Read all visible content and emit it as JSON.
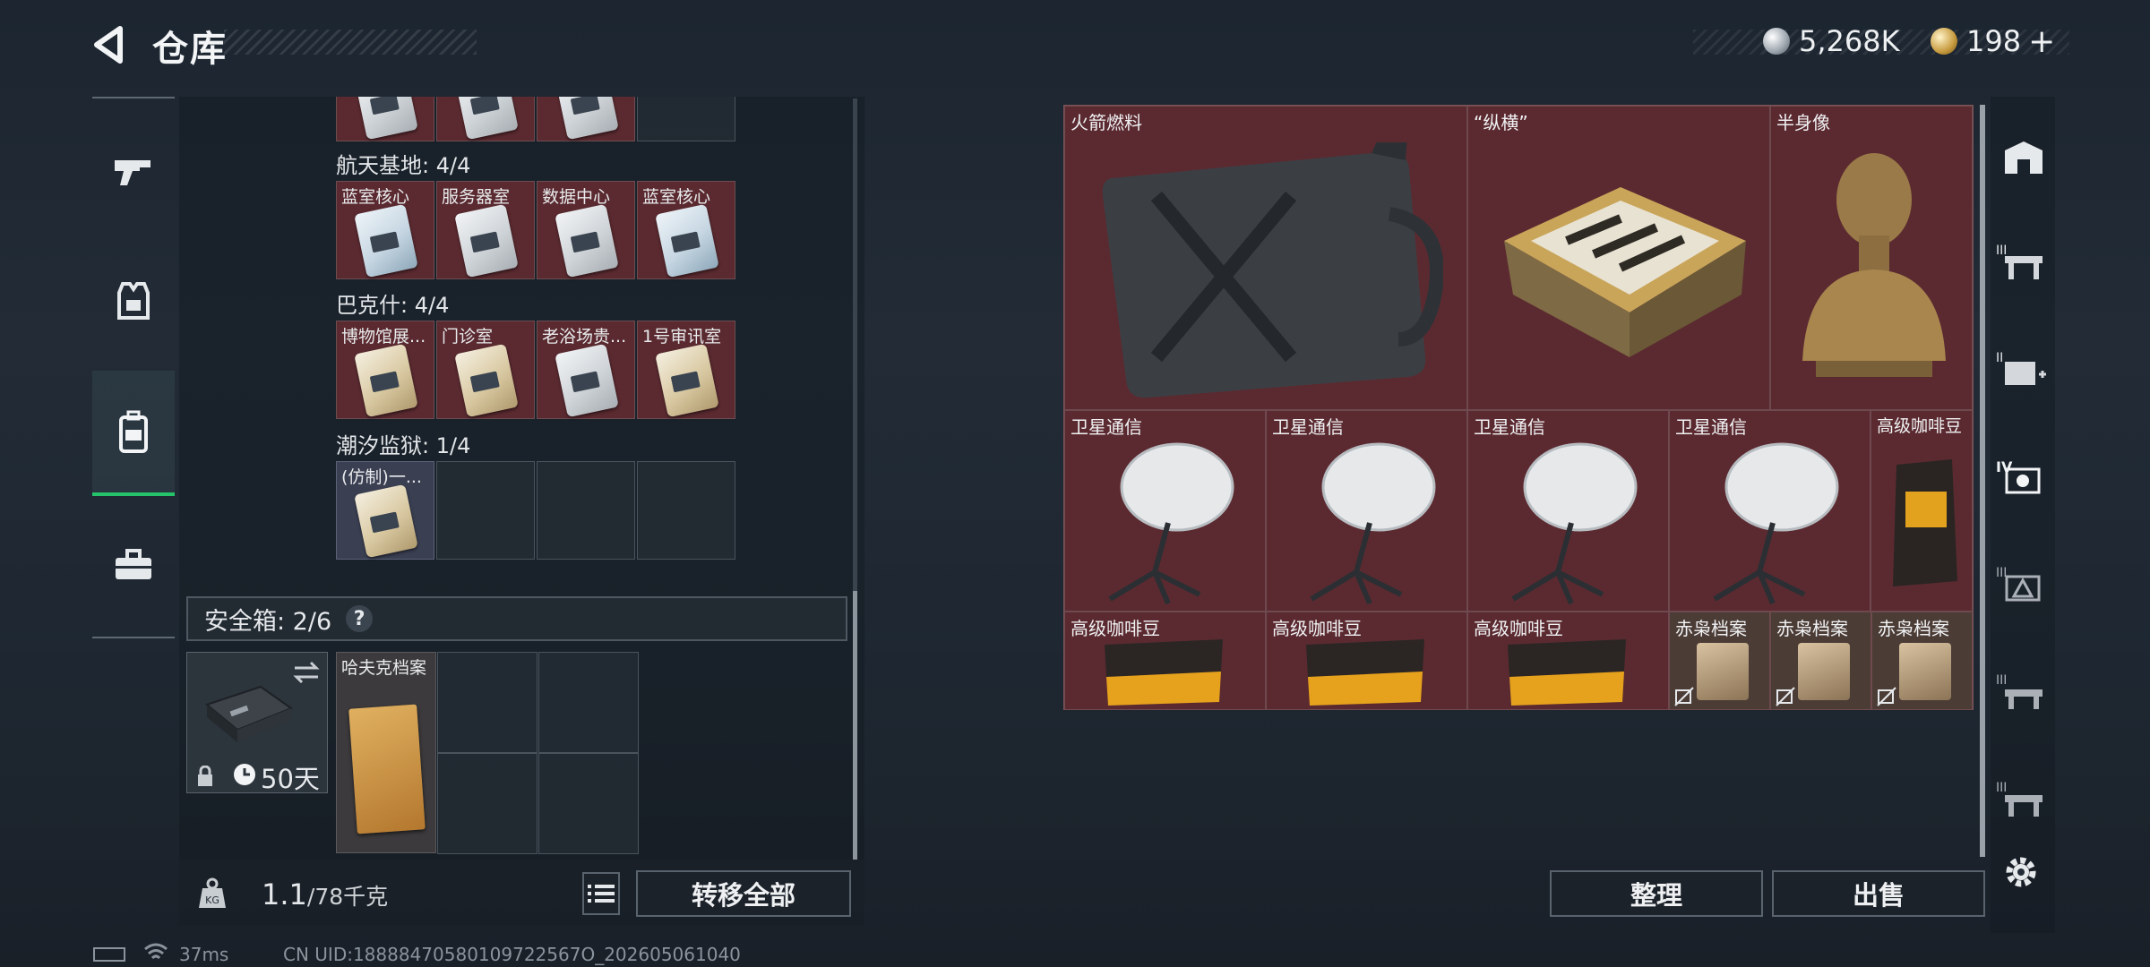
{
  "header": {
    "title": "仓库"
  },
  "currency": [
    {
      "icon": "silver-coin-icon",
      "value": "5,268K"
    },
    {
      "icon": "gold-coin-icon",
      "value": "198",
      "plus": "+"
    }
  ],
  "left_nav": [
    {
      "icon": "gun-icon",
      "active": false
    },
    {
      "icon": "armor-vest-icon",
      "active": false
    },
    {
      "icon": "backpack-icon",
      "active": true
    },
    {
      "icon": "toolbox-icon",
      "active": false
    }
  ],
  "keycard_groups": [
    {
      "title": "航天基地: 4/4",
      "slots": [
        "蓝室核心",
        "服务器室",
        "数据中心",
        "蓝室核心"
      ]
    },
    {
      "title": "巴克什: 4/4",
      "slots": [
        "博物馆展...",
        "门诊室",
        "老浴场贵...",
        "1号审讯室"
      ]
    },
    {
      "title": "潮汐监狱: 1/4",
      "slots": [
        "(仿制)一...",
        "",
        "",
        ""
      ]
    }
  ],
  "safe_box": {
    "title": "安全箱:  2/6",
    "help": "?",
    "days": "50天",
    "item_label": "哈夫克档案"
  },
  "bottom_left": {
    "weight_value": "1.1",
    "weight_total": "/78千克",
    "transfer_all": "转移全部"
  },
  "stash_items": [
    {
      "label": "火箭燃料"
    },
    {
      "label": "“纵横”"
    },
    {
      "label": "半身像"
    },
    {
      "label": "卫星通信"
    },
    {
      "label": "卫星通信"
    },
    {
      "label": "卫星通信"
    },
    {
      "label": "卫星通信"
    },
    {
      "label": "高级咖啡豆"
    },
    {
      "label": "高级咖啡豆"
    },
    {
      "label": "高级咖啡豆"
    },
    {
      "label": "高级咖啡豆"
    },
    {
      "label": "赤枭档案"
    },
    {
      "label": "赤枭档案"
    },
    {
      "label": "赤枭档案"
    }
  ],
  "right_nav": [
    {
      "icon": "vault-icon",
      "level": ""
    },
    {
      "icon": "workbench-icon",
      "level": "III"
    },
    {
      "icon": "medical-station-icon",
      "level": "II"
    },
    {
      "icon": "tech-center-icon",
      "level": "IV"
    },
    {
      "icon": "armor-bench-icon",
      "level": "III"
    },
    {
      "icon": "gym-icon",
      "level": "III"
    },
    {
      "icon": "workbench-2-icon",
      "level": "III"
    }
  ],
  "actions": {
    "organize": "整理",
    "sell": "出售"
  },
  "status_bar": {
    "ping": "37ms",
    "uid": "CN UID:18888470580109722567O_202605061040"
  }
}
